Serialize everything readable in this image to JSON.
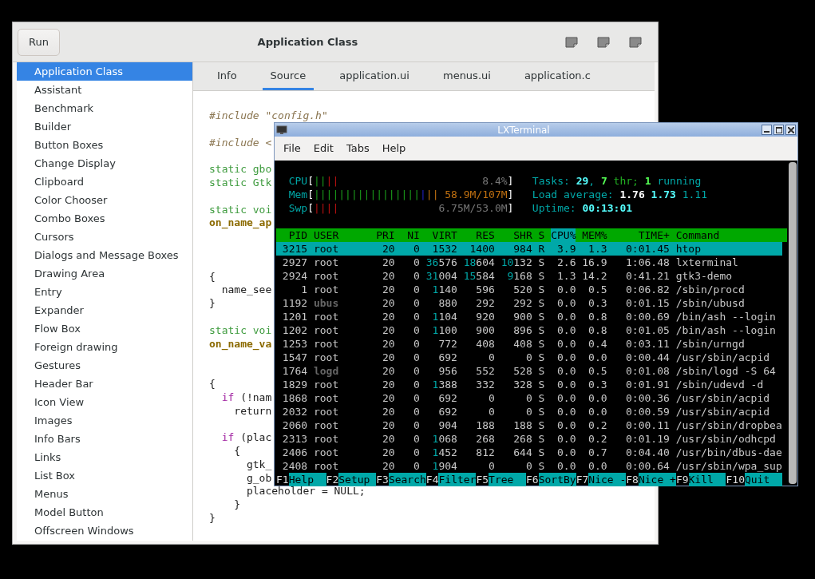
{
  "app_window": {
    "run_button": "Run",
    "title": "Application Class",
    "sidebar": [
      {
        "label": "Application Class",
        "selected": true
      },
      {
        "label": "Assistant",
        "selected": false
      },
      {
        "label": "Benchmark",
        "selected": false
      },
      {
        "label": "Builder",
        "selected": false
      },
      {
        "label": "Button Boxes",
        "selected": false
      },
      {
        "label": "Change Display",
        "selected": false
      },
      {
        "label": "Clipboard",
        "selected": false
      },
      {
        "label": "Color Chooser",
        "selected": false
      },
      {
        "label": "Combo Boxes",
        "selected": false
      },
      {
        "label": "Cursors",
        "selected": false
      },
      {
        "label": "Dialogs and Message Boxes",
        "selected": false
      },
      {
        "label": "Drawing Area",
        "selected": false
      },
      {
        "label": "Entry",
        "selected": false
      },
      {
        "label": "Expander",
        "selected": false
      },
      {
        "label": "Flow Box",
        "selected": false
      },
      {
        "label": "Foreign drawing",
        "selected": false
      },
      {
        "label": "Gestures",
        "selected": false
      },
      {
        "label": "Header Bar",
        "selected": false
      },
      {
        "label": "Icon View",
        "selected": false
      },
      {
        "label": "Images",
        "selected": false
      },
      {
        "label": "Info Bars",
        "selected": false
      },
      {
        "label": "Links",
        "selected": false
      },
      {
        "label": "List Box",
        "selected": false
      },
      {
        "label": "Menus",
        "selected": false
      },
      {
        "label": "Model Button",
        "selected": false
      },
      {
        "label": "Offscreen Windows",
        "selected": false
      }
    ],
    "tabs": [
      {
        "label": "Info",
        "selected": false
      },
      {
        "label": "Source",
        "selected": true
      },
      {
        "label": "application.ui",
        "selected": false
      },
      {
        "label": "menus.ui",
        "selected": false
      },
      {
        "label": "application.c",
        "selected": false
      }
    ],
    "code_lines": [
      {
        "kind": "code",
        "segments": [
          {
            "kind": "preproc",
            "text": "#include \"config.h\""
          }
        ]
      },
      {
        "kind": "blank"
      },
      {
        "kind": "code",
        "segments": [
          {
            "kind": "preproc",
            "text": "#include <"
          }
        ]
      },
      {
        "kind": "blank"
      },
      {
        "kind": "code",
        "segments": [
          {
            "kind": "type",
            "text": "static gbo"
          }
        ]
      },
      {
        "kind": "code",
        "segments": [
          {
            "kind": "type",
            "text": "static Gtk"
          }
        ]
      },
      {
        "kind": "blank"
      },
      {
        "kind": "code",
        "segments": [
          {
            "kind": "type",
            "text": "static voi"
          }
        ]
      },
      {
        "kind": "code",
        "segments": [
          {
            "kind": "func",
            "text": "on_name_ap"
          }
        ]
      },
      {
        "kind": "blank"
      },
      {
        "kind": "blank"
      },
      {
        "kind": "blank"
      },
      {
        "kind": "code",
        "segments": [
          {
            "kind": "plain",
            "text": "{"
          }
        ]
      },
      {
        "kind": "code",
        "segments": [
          {
            "kind": "plain",
            "text": "  name_see"
          }
        ]
      },
      {
        "kind": "code",
        "segments": [
          {
            "kind": "plain",
            "text": "}"
          }
        ]
      },
      {
        "kind": "blank"
      },
      {
        "kind": "code",
        "segments": [
          {
            "kind": "type",
            "text": "static voi"
          }
        ]
      },
      {
        "kind": "code",
        "segments": [
          {
            "kind": "func",
            "text": "on_name_va"
          }
        ]
      },
      {
        "kind": "blank"
      },
      {
        "kind": "blank"
      },
      {
        "kind": "code",
        "segments": [
          {
            "kind": "plain",
            "text": "{"
          }
        ]
      },
      {
        "kind": "code",
        "segments": [
          {
            "kind": "keyword",
            "text": "  if"
          },
          {
            "kind": "plain",
            "text": " (!nam"
          }
        ]
      },
      {
        "kind": "code",
        "segments": [
          {
            "kind": "plain",
            "text": "    return"
          }
        ]
      },
      {
        "kind": "blank"
      },
      {
        "kind": "code",
        "segments": [
          {
            "kind": "keyword",
            "text": "  if"
          },
          {
            "kind": "plain",
            "text": " (plac"
          }
        ]
      },
      {
        "kind": "code",
        "segments": [
          {
            "kind": "plain",
            "text": "    {"
          }
        ]
      },
      {
        "kind": "code",
        "segments": [
          {
            "kind": "plain",
            "text": "      gtk_"
          }
        ]
      },
      {
        "kind": "code",
        "segments": [
          {
            "kind": "plain",
            "text": "      g_ob"
          }
        ]
      },
      {
        "kind": "code",
        "segments": [
          {
            "kind": "plain",
            "text": "      placeholder = NULL;"
          }
        ]
      },
      {
        "kind": "code",
        "segments": [
          {
            "kind": "plain",
            "text": "    }"
          }
        ]
      },
      {
        "kind": "code",
        "segments": [
          {
            "kind": "plain",
            "text": "}"
          }
        ]
      }
    ]
  },
  "terminal": {
    "title": "LXTerminal",
    "menu": [
      "File",
      "Edit",
      "Tabs",
      "Help"
    ],
    "meters": [
      {
        "label": "CPU",
        "open": "[",
        "close": "]",
        "segments": [
          {
            "kind": "user",
            "text": "||"
          },
          {
            "kind": "kernel",
            "text": "||"
          }
        ],
        "reading": {
          "kind": "plain",
          "text": "8.4%"
        }
      },
      {
        "label": "Mem",
        "open": "[",
        "close": "]",
        "segments": [
          {
            "kind": "user",
            "text": "|||||||||||||||||"
          },
          {
            "kind": "buffers",
            "text": "|"
          },
          {
            "kind": "cache",
            "text": "||"
          }
        ],
        "reading": {
          "kind": "cache",
          "text": "58.9M/107M"
        }
      },
      {
        "label": "Swp",
        "open": "[",
        "close": "]",
        "segments": [
          {
            "kind": "kernel",
            "text": "||||"
          }
        ],
        "reading": {
          "kind": "plain",
          "text": "6.75M/53.0M"
        }
      }
    ],
    "summary": [
      [
        {
          "kind": "label",
          "text": "Tasks: "
        },
        {
          "kind": "value",
          "text": "29"
        },
        {
          "kind": "label",
          "text": ", "
        },
        {
          "kind": "value-green",
          "text": "7"
        },
        {
          "kind": "green",
          "text": " thr; "
        },
        {
          "kind": "value-green",
          "text": "1"
        },
        {
          "kind": "label",
          "text": " running"
        }
      ],
      [
        {
          "kind": "label",
          "text": "Load average: "
        },
        {
          "kind": "value-white",
          "text": "1.76"
        },
        {
          "kind": "value",
          "text": " 1.73"
        },
        {
          "kind": "label",
          "text": " 1.11"
        }
      ],
      [
        {
          "kind": "label",
          "text": "Uptime: "
        },
        {
          "kind": "value",
          "text": "00:13:01"
        }
      ]
    ],
    "columns": [
      {
        "label": "PID",
        "sorted": false
      },
      {
        "label": "USER",
        "sorted": false
      },
      {
        "label": "PRI",
        "sorted": false
      },
      {
        "label": "NI",
        "sorted": false
      },
      {
        "label": "VIRT",
        "sorted": false
      },
      {
        "label": "RES",
        "sorted": false
      },
      {
        "label": "SHR",
        "sorted": false
      },
      {
        "label": "S",
        "sorted": false
      },
      {
        "label": "CPU%",
        "sorted": true
      },
      {
        "label": "MEM%",
        "sorted": false
      },
      {
        "label": "TIME+",
        "sorted": false
      },
      {
        "label": "Command",
        "sorted": false
      }
    ],
    "rows": [
      {
        "selected": true,
        "user_dimmed": false,
        "cells": [
          "3215",
          "root",
          "20",
          "0",
          "1532",
          "1400",
          "984",
          "R",
          "3.9",
          "1.3",
          "0:01.45",
          "htop"
        ]
      },
      {
        "selected": false,
        "user_dimmed": false,
        "cells": [
          "2927",
          "root",
          "20",
          "0",
          "36576",
          "18604",
          "10132",
          "S",
          "2.6",
          "16.9",
          "1:06.48",
          "lxterminal"
        ]
      },
      {
        "selected": false,
        "user_dimmed": false,
        "cells": [
          "2924",
          "root",
          "20",
          "0",
          "31004",
          "15584",
          "9168",
          "S",
          "1.3",
          "14.2",
          "0:41.21",
          "gtk3-demo"
        ]
      },
      {
        "selected": false,
        "user_dimmed": false,
        "cells": [
          "1",
          "root",
          "20",
          "0",
          "1140",
          "596",
          "520",
          "S",
          "0.0",
          "0.5",
          "0:06.82",
          "/sbin/procd"
        ]
      },
      {
        "selected": false,
        "user_dimmed": true,
        "cells": [
          "1192",
          "ubus",
          "20",
          "0",
          "880",
          "292",
          "292",
          "S",
          "0.0",
          "0.3",
          "0:01.15",
          "/sbin/ubusd"
        ]
      },
      {
        "selected": false,
        "user_dimmed": false,
        "cells": [
          "1201",
          "root",
          "20",
          "0",
          "1104",
          "920",
          "900",
          "S",
          "0.0",
          "0.8",
          "0:00.69",
          "/bin/ash --login"
        ]
      },
      {
        "selected": false,
        "user_dimmed": false,
        "cells": [
          "1202",
          "root",
          "20",
          "0",
          "1100",
          "900",
          "896",
          "S",
          "0.0",
          "0.8",
          "0:01.05",
          "/bin/ash --login"
        ]
      },
      {
        "selected": false,
        "user_dimmed": false,
        "cells": [
          "1253",
          "root",
          "20",
          "0",
          "772",
          "408",
          "408",
          "S",
          "0.0",
          "0.4",
          "0:03.11",
          "/sbin/urngd"
        ]
      },
      {
        "selected": false,
        "user_dimmed": false,
        "cells": [
          "1547",
          "root",
          "20",
          "0",
          "692",
          "0",
          "0",
          "S",
          "0.0",
          "0.0",
          "0:00.44",
          "/usr/sbin/acpid"
        ]
      },
      {
        "selected": false,
        "user_dimmed": true,
        "cells": [
          "1764",
          "logd",
          "20",
          "0",
          "956",
          "552",
          "528",
          "S",
          "0.0",
          "0.5",
          "0:01.08",
          "/sbin/logd -S 64"
        ]
      },
      {
        "selected": false,
        "user_dimmed": false,
        "cells": [
          "1829",
          "root",
          "20",
          "0",
          "1388",
          "332",
          "328",
          "S",
          "0.0",
          "0.3",
          "0:01.91",
          "/sbin/udevd -d"
        ]
      },
      {
        "selected": false,
        "user_dimmed": false,
        "cells": [
          "1868",
          "root",
          "20",
          "0",
          "692",
          "0",
          "0",
          "S",
          "0.0",
          "0.0",
          "0:00.36",
          "/usr/sbin/acpid"
        ]
      },
      {
        "selected": false,
        "user_dimmed": false,
        "cells": [
          "2032",
          "root",
          "20",
          "0",
          "692",
          "0",
          "0",
          "S",
          "0.0",
          "0.0",
          "0:00.59",
          "/usr/sbin/acpid"
        ]
      },
      {
        "selected": false,
        "user_dimmed": false,
        "cells": [
          "2060",
          "root",
          "20",
          "0",
          "904",
          "188",
          "188",
          "S",
          "0.0",
          "0.2",
          "0:00.11",
          "/usr/sbin/dropbea"
        ]
      },
      {
        "selected": false,
        "user_dimmed": false,
        "cells": [
          "2313",
          "root",
          "20",
          "0",
          "1068",
          "268",
          "268",
          "S",
          "0.0",
          "0.2",
          "0:01.19",
          "/usr/sbin/odhcpd"
        ]
      },
      {
        "selected": false,
        "user_dimmed": false,
        "cells": [
          "2406",
          "root",
          "20",
          "0",
          "1452",
          "812",
          "644",
          "S",
          "0.0",
          "0.7",
          "0:04.40",
          "/usr/bin/dbus-dae"
        ]
      },
      {
        "selected": false,
        "user_dimmed": false,
        "cells": [
          "2408",
          "root",
          "20",
          "0",
          "1904",
          "0",
          "0",
          "S",
          "0.0",
          "0.0",
          "0:00.64",
          "/usr/sbin/wpa_sup"
        ]
      }
    ],
    "function_keys": [
      {
        "key": "F1",
        "label": "Help"
      },
      {
        "key": "F2",
        "label": "Setup"
      },
      {
        "key": "F3",
        "label": "Search"
      },
      {
        "key": "F4",
        "label": "Filter"
      },
      {
        "key": "F5",
        "label": "Tree"
      },
      {
        "key": "F6",
        "label": "SortBy"
      },
      {
        "key": "F7",
        "label": "Nice -"
      },
      {
        "key": "F8",
        "label": "Nice +"
      },
      {
        "key": "F9",
        "label": "Kill"
      },
      {
        "key": "F10",
        "label": "Quit"
      }
    ]
  }
}
